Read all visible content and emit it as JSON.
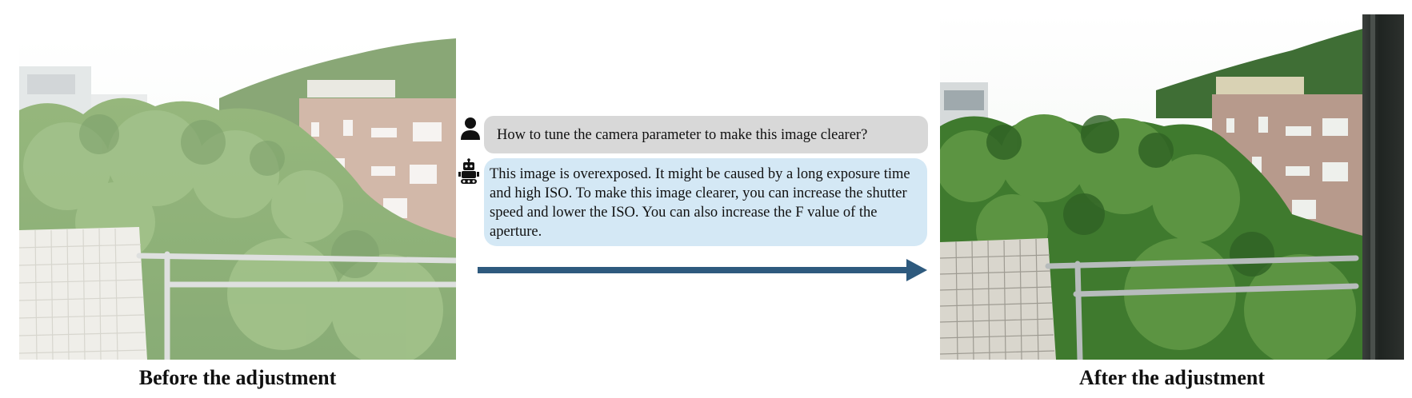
{
  "captions": {
    "before": "Before the adjustment",
    "after": "After the adjustment"
  },
  "chat": {
    "user_icon": "person-icon",
    "bot_icon": "robot-icon",
    "question": "How to tune the camera parameter to make this image clearer?",
    "answer": "This image is overexposed. It might be caused by a long exposure time and high ISO. To make this image clearer, you can increase the shutter speed  and lower the ISO. You can also increase the F value of the aperture."
  },
  "arrow_color": "#2e5a7e",
  "question_bubble_color": "#d8d8d8",
  "answer_bubble_color": "#d4e8f5"
}
